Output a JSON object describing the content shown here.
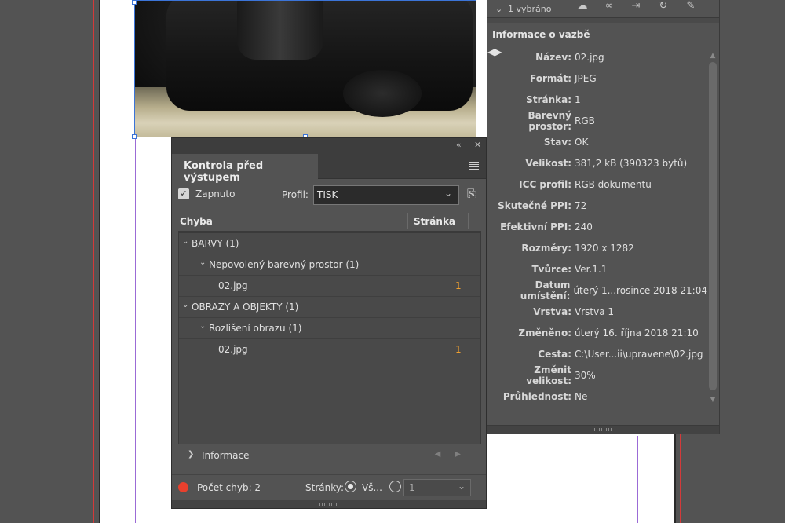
{
  "links_panel": {
    "selection_label": "1 vybráno",
    "info_title": "Informace o vazbě",
    "rows": [
      {
        "key": "Název:",
        "value": "02.jpg"
      },
      {
        "key": "Formát:",
        "value": "JPEG"
      },
      {
        "key": "Stránka:",
        "value": "1"
      },
      {
        "key": "Barevný prostor:",
        "value": "RGB"
      },
      {
        "key": "Stav:",
        "value": "OK"
      },
      {
        "key": "Velikost:",
        "value": "381,2 kB (390323 bytů)"
      },
      {
        "key": "ICC profil:",
        "value": "RGB dokumentu"
      },
      {
        "key": "Skutečné PPI:",
        "value": "72"
      },
      {
        "key": "Efektivní PPI:",
        "value": "240"
      },
      {
        "key": "Rozměry:",
        "value": "1920 x 1282"
      },
      {
        "key": "Tvůrce:",
        "value": "Ver.1.1"
      },
      {
        "key": "Datum umístění:",
        "value": "úterý 1...rosince 2018 21:04"
      },
      {
        "key": "Vrstva:",
        "value": "Vrstva 1"
      },
      {
        "key": "Změněno:",
        "value": "úterý 16. října 2018 21:10"
      },
      {
        "key": "Cesta:",
        "value": "C:\\User...ii\\upravene\\02.jpg"
      },
      {
        "key": "Změnit velikost:",
        "value": "30%"
      },
      {
        "key": "Průhlednost:",
        "value": "Ne"
      }
    ]
  },
  "preflight": {
    "tab_title": "Kontrola před výstupem",
    "enabled_label": "Zapnuto",
    "enabled": true,
    "profile_label": "Profil:",
    "profile_value": "TISK",
    "col_error": "Chyba",
    "col_page": "Stránka",
    "items": [
      {
        "label": "BARVY (1)",
        "level": 0,
        "page": ""
      },
      {
        "label": "Nepovolený barevný prostor (1)",
        "level": 1,
        "page": ""
      },
      {
        "label": "02.jpg",
        "level": 2,
        "page": "1"
      },
      {
        "label": "OBRAZY A OBJEKTY (1)",
        "level": 0,
        "page": ""
      },
      {
        "label": "Rozlišení obrazu (1)",
        "level": 1,
        "page": ""
      },
      {
        "label": "02.jpg",
        "level": 2,
        "page": "1"
      }
    ],
    "info_label": "Informace",
    "error_count_label": "Počet chyb: 2",
    "status_color": "#e8402d",
    "pages_label": "Stránky:",
    "all_label": "Vš...",
    "page_range_value": "1"
  }
}
